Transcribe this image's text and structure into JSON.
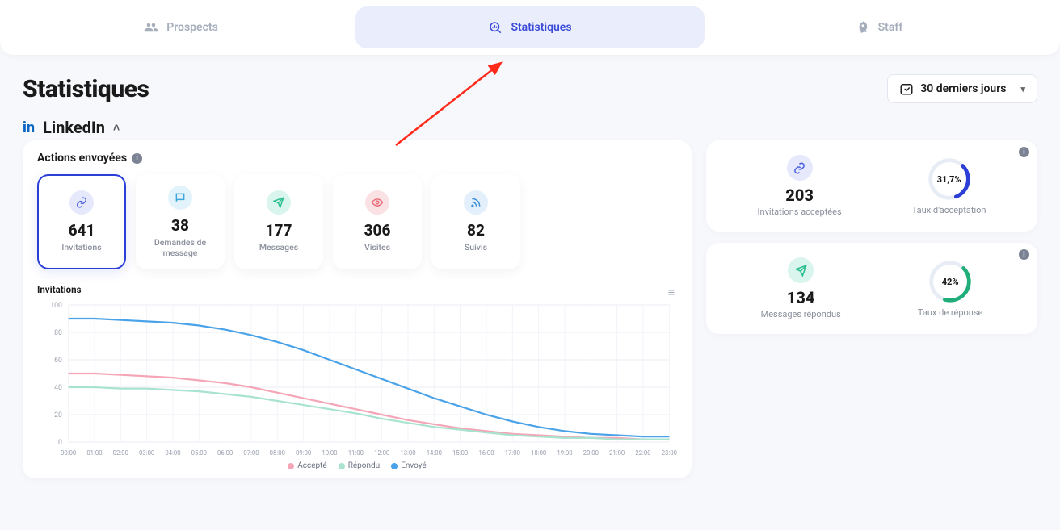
{
  "nav": {
    "prospects": "Prospects",
    "stats": "Statistiques",
    "staff": "Staff"
  },
  "page": {
    "title": "Statistiques",
    "date_range": "30 derniers jours"
  },
  "section": {
    "platform": "LinkedIn",
    "actions_heading": "Actions envoyées"
  },
  "cards": {
    "invitations": {
      "value": "641",
      "label": "Invitations"
    },
    "msg_requests": {
      "value": "38",
      "label": "Demandes de message"
    },
    "messages": {
      "value": "177",
      "label": "Messages"
    },
    "visits": {
      "value": "306",
      "label": "Visites"
    },
    "follows": {
      "value": "82",
      "label": "Suivis"
    }
  },
  "chart": {
    "title": "Invitations",
    "legend": {
      "accepted": "Accepté",
      "replied": "Répondu",
      "sent": "Envoyé"
    },
    "colors": {
      "accepted": "#f4a6b6",
      "replied": "#a8e3cf",
      "sent": "#4aa3e8"
    }
  },
  "chart_data": {
    "type": "line",
    "categories": [
      "00:00",
      "01:00",
      "02:00",
      "03:00",
      "04:00",
      "05:00",
      "06:00",
      "07:00",
      "08:00",
      "09:00",
      "10:00",
      "11:00",
      "12:00",
      "13:00",
      "14:00",
      "15:00",
      "16:00",
      "17:00",
      "18:00",
      "19:00",
      "20:00",
      "21:00",
      "22:00",
      "23:00"
    ],
    "series": [
      {
        "name": "Envoyé",
        "values": [
          90,
          90,
          89,
          88,
          87,
          85,
          82,
          78,
          73,
          67,
          60,
          53,
          46,
          39,
          32,
          26,
          20,
          15,
          11,
          8,
          6,
          5,
          4,
          4
        ]
      },
      {
        "name": "Accepté",
        "values": [
          50,
          50,
          49,
          48,
          47,
          45,
          43,
          40,
          36,
          32,
          28,
          24,
          20,
          16,
          13,
          10,
          8,
          6,
          5,
          4,
          3,
          3,
          2,
          2
        ]
      },
      {
        "name": "Répondu",
        "values": [
          40,
          40,
          39,
          39,
          38,
          37,
          35,
          33,
          30,
          27,
          24,
          21,
          17,
          14,
          11,
          9,
          7,
          5,
          4,
          3,
          3,
          2,
          2,
          2
        ]
      }
    ],
    "ylim": [
      0,
      100
    ],
    "yticks": [
      0,
      20,
      40,
      60,
      80,
      100
    ],
    "xlabel": "",
    "ylabel": ""
  },
  "kpi": {
    "accepted": {
      "value": "203",
      "label": "Invitations acceptées",
      "rate": "31,7%",
      "rate_label": "Taux d'acceptation",
      "ring_color": "#2b3fd6",
      "ring_pct": 31.7
    },
    "replied": {
      "value": "134",
      "label": "Messages répondus",
      "rate": "42%",
      "rate_label": "Taux de réponse",
      "ring_color": "#1fae7a",
      "ring_pct": 42
    }
  }
}
